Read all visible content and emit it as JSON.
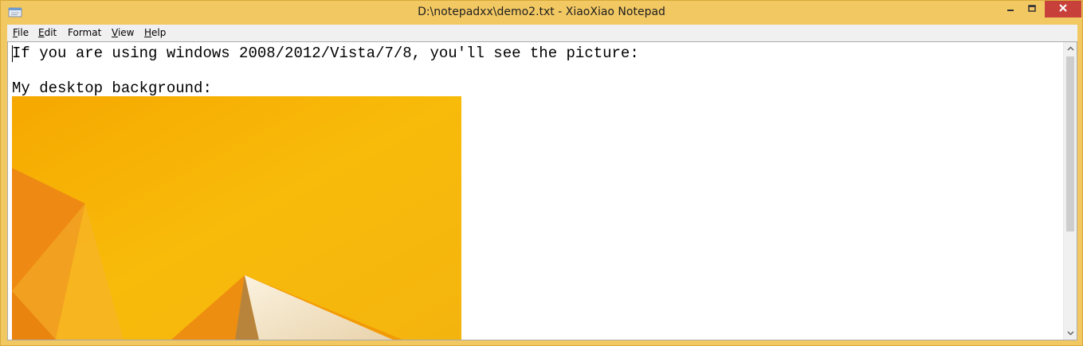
{
  "window": {
    "title": "D:\\notepadxx\\demo2.txt - XiaoXiao Notepad",
    "icon": "notepad-app-icon",
    "controls": {
      "minimize_icon": "minimize-icon",
      "maximize_icon": "maximize-icon",
      "close_icon": "close-icon"
    },
    "colors": {
      "frame": "#f2c863",
      "close_button": "#c7413a"
    }
  },
  "menubar": {
    "items": [
      {
        "mnemonic": "F",
        "rest": "ile"
      },
      {
        "mnemonic": "E",
        "rest": "dit"
      },
      {
        "mnemonic": "F",
        "rest": "ormat",
        "prefix": ""
      },
      {
        "mnemonic": "V",
        "rest": "iew"
      },
      {
        "mnemonic": "H",
        "rest": "elp"
      }
    ]
  },
  "document": {
    "lines": [
      "If you are using windows 2008/2012/Vista/7/8, you'll see the picture:",
      "",
      "My desktop background:"
    ],
    "embedded_image": "windows-8-yellow-wallpaper",
    "image_colors": {
      "background": "#f7b500",
      "accent": "#f08c00",
      "light_shape": "#f3e5c9"
    }
  },
  "scrollbar": {
    "up_icon": "scroll-up-arrow-icon",
    "down_icon": "scroll-down-arrow-icon"
  }
}
